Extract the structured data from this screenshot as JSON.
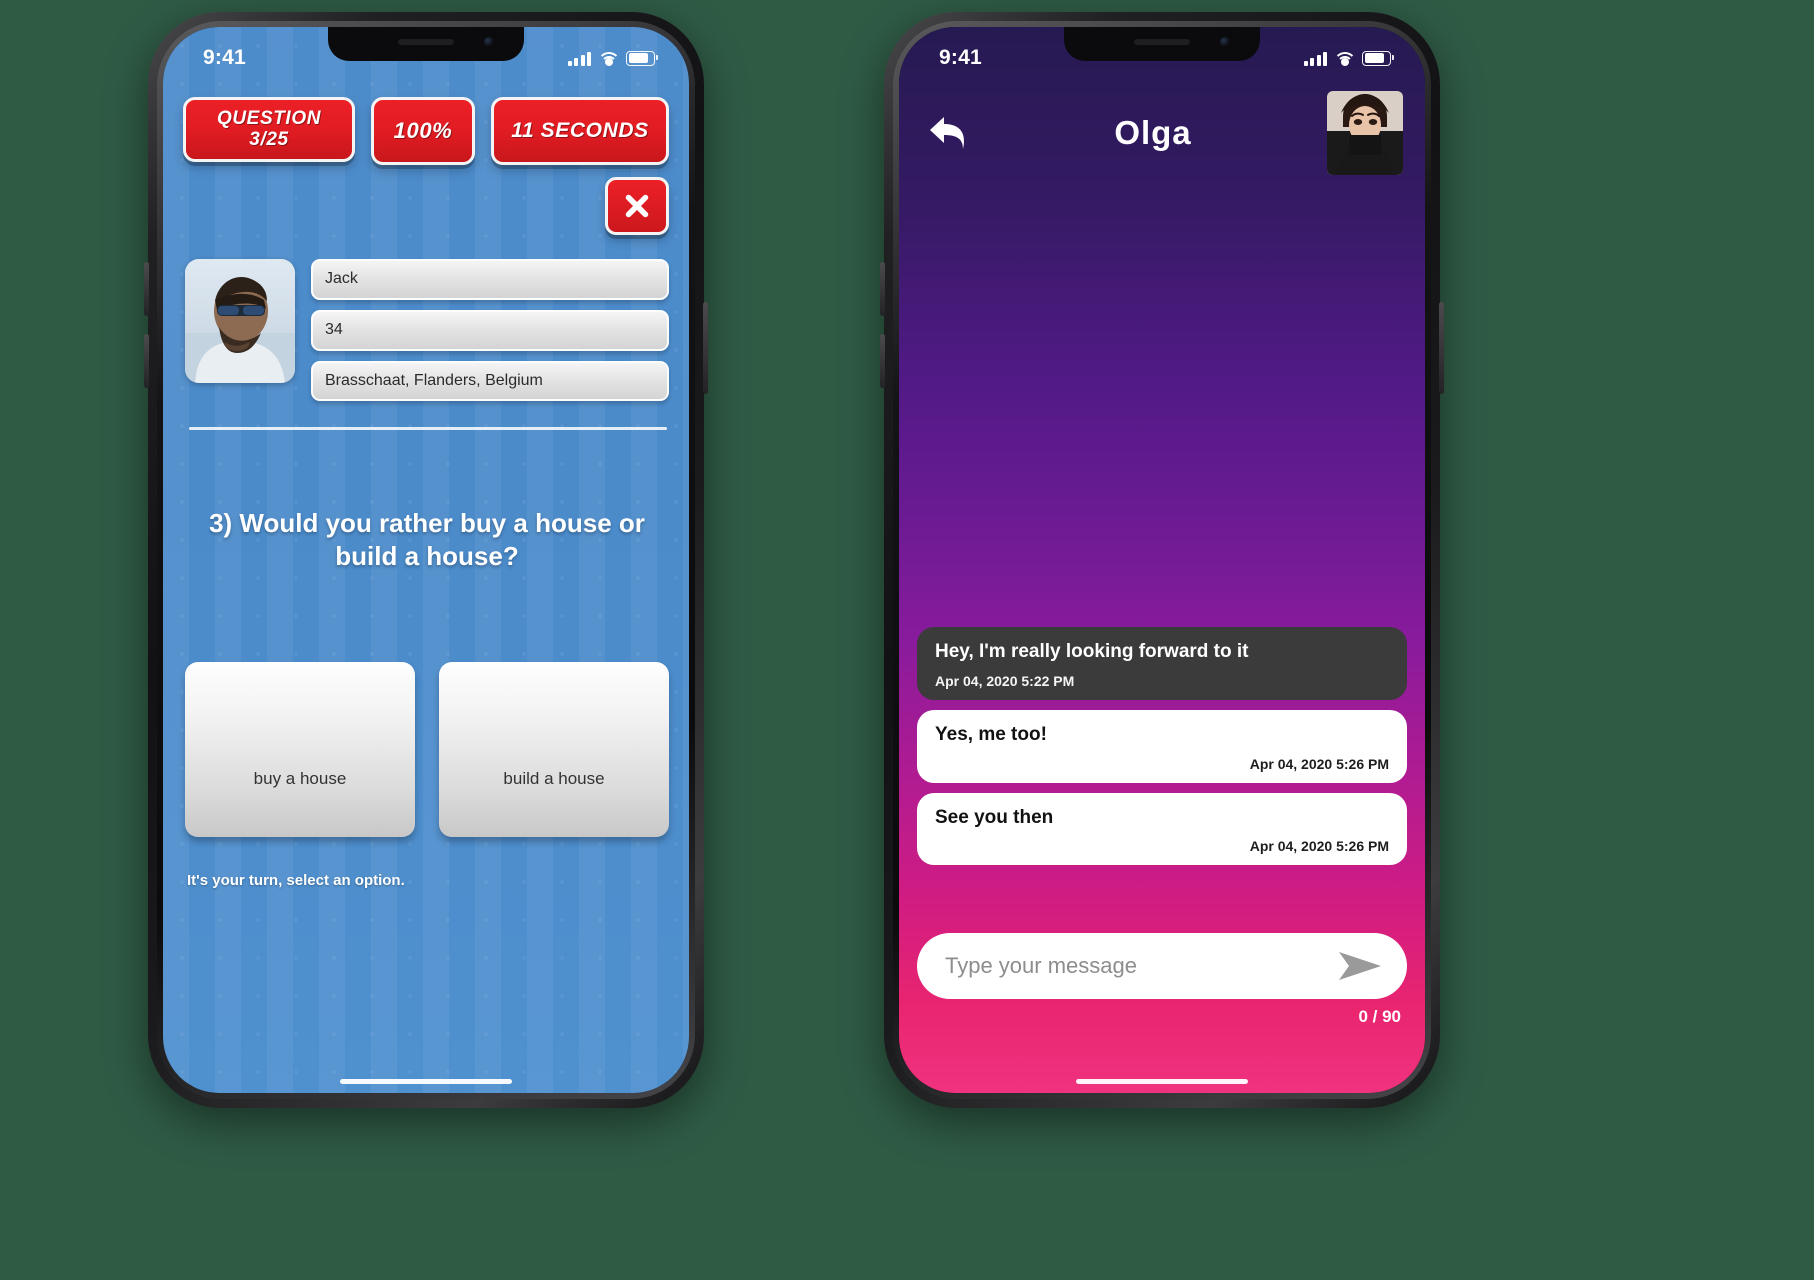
{
  "quiz_phone": {
    "status_bar": {
      "time": "9:41",
      "signal_icon": "cellular-signal-icon",
      "wifi_icon": "wifi-icon",
      "battery_icon": "battery-icon"
    },
    "badges": {
      "question_line1": "QUESTION",
      "question_line2": "3/25",
      "percent": "100%",
      "timer": "11 SECONDS"
    },
    "close_label": "close-icon",
    "profile": {
      "avatar": "player-photo",
      "name": "Jack",
      "age": "34",
      "location": "Brasschaat, Flanders, Belgium"
    },
    "question": "3) Would you rather buy a house or build a house?",
    "answers": [
      {
        "label": "buy a house"
      },
      {
        "label": "build a house"
      }
    ],
    "turn_note": "It's your turn, select an option."
  },
  "chat_phone": {
    "status_bar": {
      "time": "9:41",
      "signal_icon": "cellular-signal-icon",
      "wifi_icon": "wifi-icon",
      "battery_icon": "battery-icon"
    },
    "header": {
      "back_icon": "back-arrow-icon",
      "title": "Olga",
      "avatar": "contact-photo"
    },
    "messages": [
      {
        "side": "them",
        "text": "Hey, I'm really looking forward to it",
        "time": "Apr 04, 2020 5:22 PM"
      },
      {
        "side": "me",
        "text": "Yes, me too!",
        "time": "Apr 04, 2020 5:26 PM"
      },
      {
        "side": "me",
        "text": "See you then",
        "time": "Apr 04, 2020 5:26 PM"
      }
    ],
    "composer": {
      "value": "",
      "placeholder": "Type your message",
      "send_icon": "send-arrow-icon",
      "counter": "0 / 90"
    }
  },
  "colors": {
    "page_background": "#2f5b45",
    "quiz_blue": "#4d8ccb",
    "badge_red": "#e01c22",
    "chat_top": "#261a52",
    "chat_bottom": "#f0337f",
    "bubble_them": "#3b3b3b",
    "bubble_me": "#ffffff"
  }
}
